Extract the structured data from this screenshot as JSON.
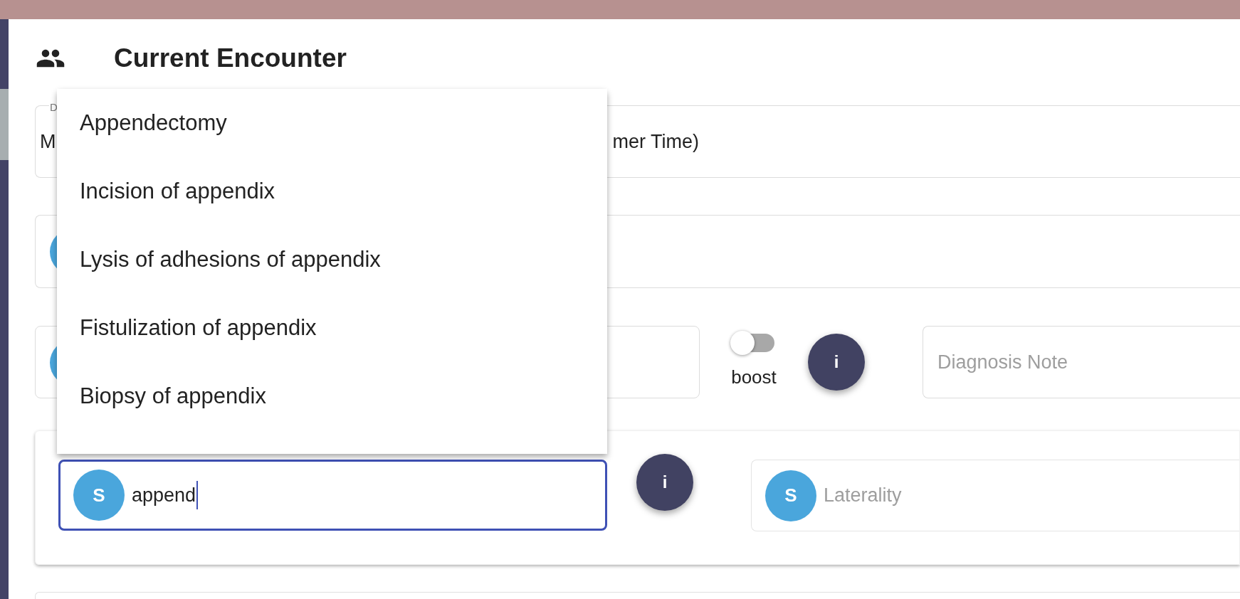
{
  "header": {
    "title": "Current Encounter"
  },
  "date_field": {
    "label": "D",
    "value_start": "M",
    "value_end": "mer Time)"
  },
  "diagnosis_row": {
    "boost": {
      "label": "boost",
      "on": false
    },
    "info_button": "i",
    "note": {
      "placeholder": "Diagnosis Note"
    }
  },
  "procedure_card": {
    "field": {
      "avatar": "S",
      "value": "append",
      "focused": true
    },
    "info_button": "i",
    "laterality": {
      "avatar": "S",
      "placeholder": "Laterality"
    }
  },
  "dropdown": {
    "options": [
      {
        "label": "Appendectomy",
        "selected": false
      },
      {
        "label": "Incision of appendix",
        "selected": false
      },
      {
        "label": "Lysis of adhesions of appendix",
        "selected": false
      },
      {
        "label": "Fistulization of appendix",
        "selected": false
      },
      {
        "label": "Biopsy of appendix",
        "selected": false
      }
    ]
  }
}
